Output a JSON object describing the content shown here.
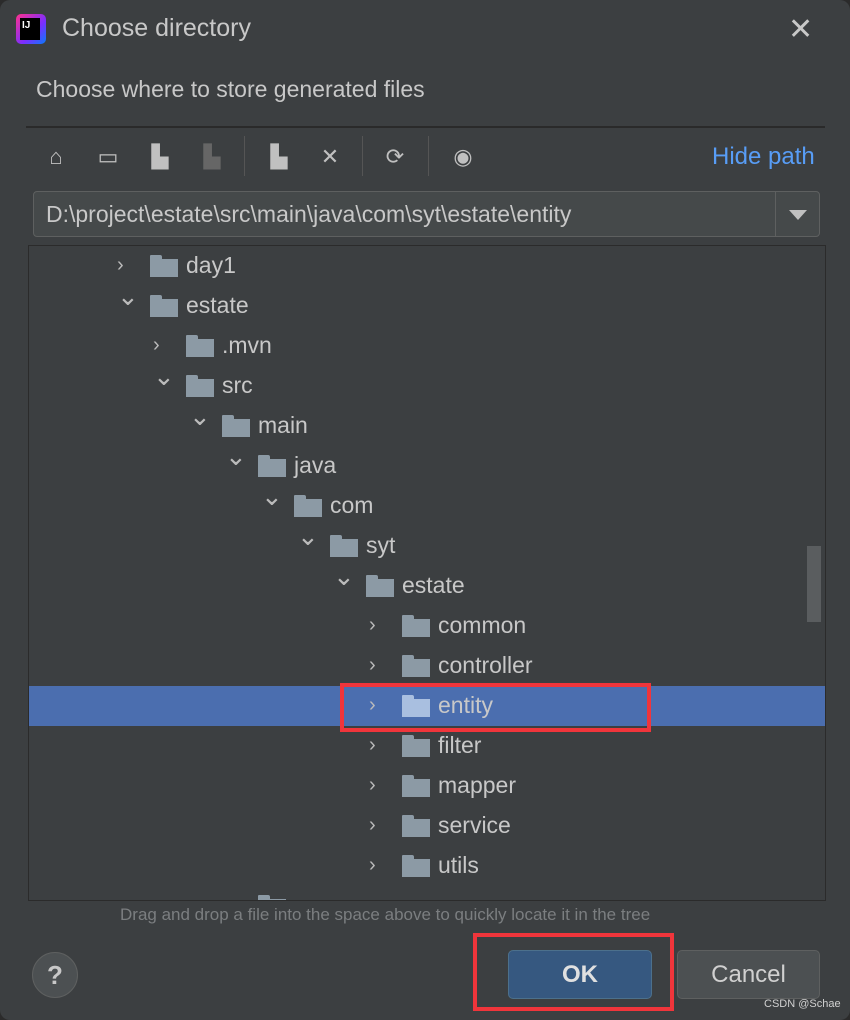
{
  "window": {
    "title": "Choose directory",
    "close_icon": "close-icon"
  },
  "subtitle": "Choose where to store generated files",
  "toolbar": {
    "icons": [
      "home-icon",
      "desktop-icon",
      "project-folder-icon",
      "module-folder-icon",
      "new-folder-icon",
      "delete-icon",
      "refresh-icon",
      "show-hidden-icon"
    ],
    "hide_path": "Hide path"
  },
  "path": {
    "value": "D:\\project\\estate\\src\\main\\java\\com\\syt\\estate\\entity"
  },
  "tree": [
    {
      "label": "day1",
      "level": 0,
      "expanded": false
    },
    {
      "label": "estate",
      "level": 0,
      "expanded": true
    },
    {
      "label": ".mvn",
      "level": 1,
      "expanded": false
    },
    {
      "label": "src",
      "level": 1,
      "expanded": true
    },
    {
      "label": "main",
      "level": 2,
      "expanded": true
    },
    {
      "label": "java",
      "level": 3,
      "expanded": true
    },
    {
      "label": "com",
      "level": 4,
      "expanded": true
    },
    {
      "label": "syt",
      "level": 5,
      "expanded": true
    },
    {
      "label": "estate",
      "level": 6,
      "expanded": true
    },
    {
      "label": "common",
      "level": 7,
      "expanded": false
    },
    {
      "label": "controller",
      "level": 7,
      "expanded": false
    },
    {
      "label": "entity",
      "level": 7,
      "expanded": false,
      "selected": true
    },
    {
      "label": "filter",
      "level": 7,
      "expanded": false
    },
    {
      "label": "mapper",
      "level": 7,
      "expanded": false
    },
    {
      "label": "service",
      "level": 7,
      "expanded": false
    },
    {
      "label": "utils",
      "level": 7,
      "expanded": false
    },
    {
      "label": "",
      "level": 3,
      "expanded": false
    }
  ],
  "hint": "Drag and drop a file into the space above to quickly locate it in the tree",
  "buttons": {
    "help": "?",
    "ok": "OK",
    "cancel": "Cancel"
  },
  "watermark": "CSDN @Schae",
  "colors": {
    "selection": "#4b6eaf",
    "accent": "#589df6",
    "ok": "#365880",
    "highlight": "#f0353b"
  }
}
